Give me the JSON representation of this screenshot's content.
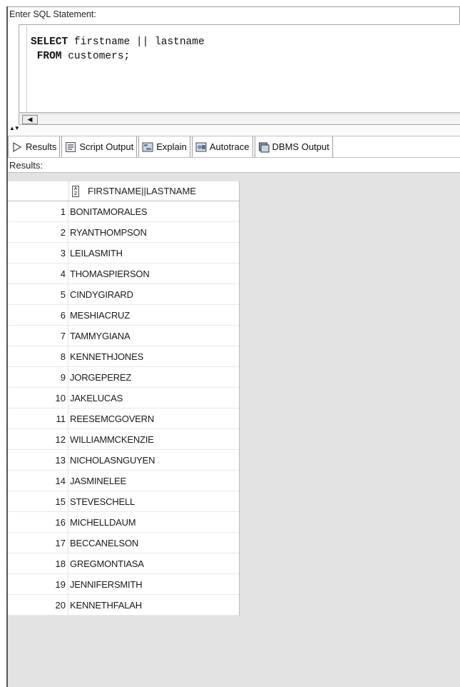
{
  "sql_label": "Enter SQL Statement:",
  "editor": {
    "line1_keyword": "SELECT",
    "line1_rest": " firstname || lastname",
    "line2_keyword": "FROM",
    "line2_rest": " customers;"
  },
  "tabs": [
    {
      "label": "Results",
      "icon": "play-icon"
    },
    {
      "label": "Script Output",
      "icon": "script-output-icon"
    },
    {
      "label": "Explain",
      "icon": "explain-icon"
    },
    {
      "label": "Autotrace",
      "icon": "autotrace-icon"
    },
    {
      "label": "DBMS Output",
      "icon": "dbms-output-icon"
    }
  ],
  "results_label": "Results:",
  "grid": {
    "column_header": "FIRSTNAME||LASTNAME",
    "rows": [
      {
        "n": "1",
        "v": "BONITAMORALES"
      },
      {
        "n": "2",
        "v": "RYANTHOMPSON"
      },
      {
        "n": "3",
        "v": "LEILASMITH"
      },
      {
        "n": "4",
        "v": "THOMASPIERSON"
      },
      {
        "n": "5",
        "v": "CINDYGIRARD"
      },
      {
        "n": "6",
        "v": "MESHIACRUZ"
      },
      {
        "n": "7",
        "v": "TAMMYGIANA"
      },
      {
        "n": "8",
        "v": "KENNETHJONES"
      },
      {
        "n": "9",
        "v": "JORGEPEREZ"
      },
      {
        "n": "10",
        "v": "JAKELUCAS"
      },
      {
        "n": "11",
        "v": "REESEMCGOVERN"
      },
      {
        "n": "12",
        "v": "WILLIAMMCKENZIE"
      },
      {
        "n": "13",
        "v": "NICHOLASNGUYEN"
      },
      {
        "n": "14",
        "v": "JASMINELEE"
      },
      {
        "n": "15",
        "v": "STEVESCHELL"
      },
      {
        "n": "16",
        "v": "MICHELLDAUM"
      },
      {
        "n": "17",
        "v": "BECCANELSON"
      },
      {
        "n": "18",
        "v": "GREGMONTIASA"
      },
      {
        "n": "19",
        "v": "JENNIFERSMITH"
      },
      {
        "n": "20",
        "v": "KENNETHFALAH"
      }
    ]
  }
}
